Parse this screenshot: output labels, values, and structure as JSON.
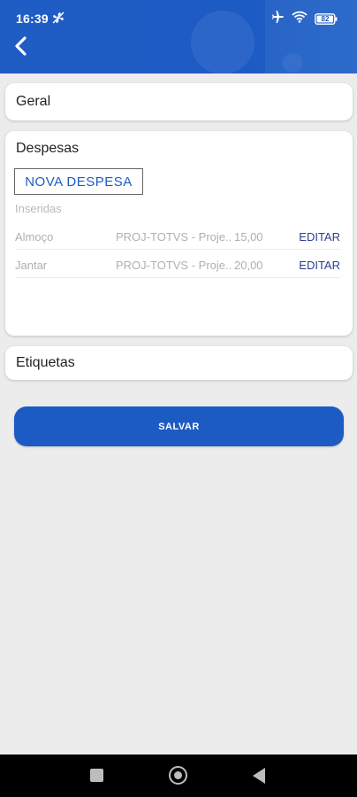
{
  "status_bar": {
    "time": "16:39",
    "icons": [
      "fan-icon",
      "airplane-icon",
      "wifi-icon",
      "battery-icon"
    ],
    "battery": "82"
  },
  "header": {
    "back_icon": "chevron-left-icon"
  },
  "sections": {
    "geral": "Geral",
    "despesas": "Despesas",
    "etiquetas": "Etiquetas"
  },
  "despesas": {
    "new_button": "NOVA DESPESA",
    "inserted_label": "Inseridas",
    "items": [
      {
        "name": "Almoço",
        "project": "PROJ-TOTVS - Proje...",
        "value": "15,00",
        "action": "EDITAR"
      },
      {
        "name": "Jantar",
        "project": "PROJ-TOTVS - Proje...",
        "value": "20,00",
        "action": "EDITAR"
      }
    ]
  },
  "actions": {
    "save": "SALVAR"
  },
  "colors": {
    "primary": "#1d5bc4",
    "edit_link": "#2b3f8f",
    "background": "#ececec"
  }
}
